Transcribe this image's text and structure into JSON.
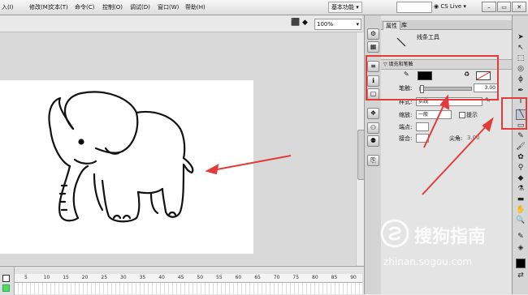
{
  "menu": {
    "items": [
      "入(I)",
      "修改(M)",
      "文本(T)",
      "命令(C)",
      "控制(O)",
      "调试(D)",
      "窗口(W)",
      "帮助(H)"
    ],
    "workspace": "基本功能 ▾",
    "cslive": "CS Live"
  },
  "window_controls": {
    "minimize": "–",
    "restore": "▭",
    "close": "✕"
  },
  "doc": {
    "zoom": "100%"
  },
  "timeline": {
    "frame_numbers": [
      "5",
      "10",
      "15",
      "20",
      "25",
      "30",
      "35",
      "40",
      "45",
      "50",
      "55",
      "60",
      "65",
      "70",
      "75",
      "80",
      "85",
      "90"
    ]
  },
  "panel": {
    "tab_properties": "属性",
    "tab_library": "库",
    "tool_name": "线条工具",
    "section_fill_stroke": "填充和笔触",
    "stroke_label": "笔触:",
    "stroke_value": "3.00",
    "style_label": "样式:",
    "style_value": "实线",
    "scale_label": "缩放:",
    "scale_value": "一般",
    "hint_label": "提示",
    "cap_label": "端点:",
    "join_label": "接合:",
    "miter_label": "尖角:",
    "miter_value": "3.00"
  },
  "watermark": {
    "text": "搜狗指南",
    "url": "zhinan.sogou.com"
  },
  "colors": {
    "annotation_red": "#e23b3b",
    "stroke_color": "#000000"
  }
}
